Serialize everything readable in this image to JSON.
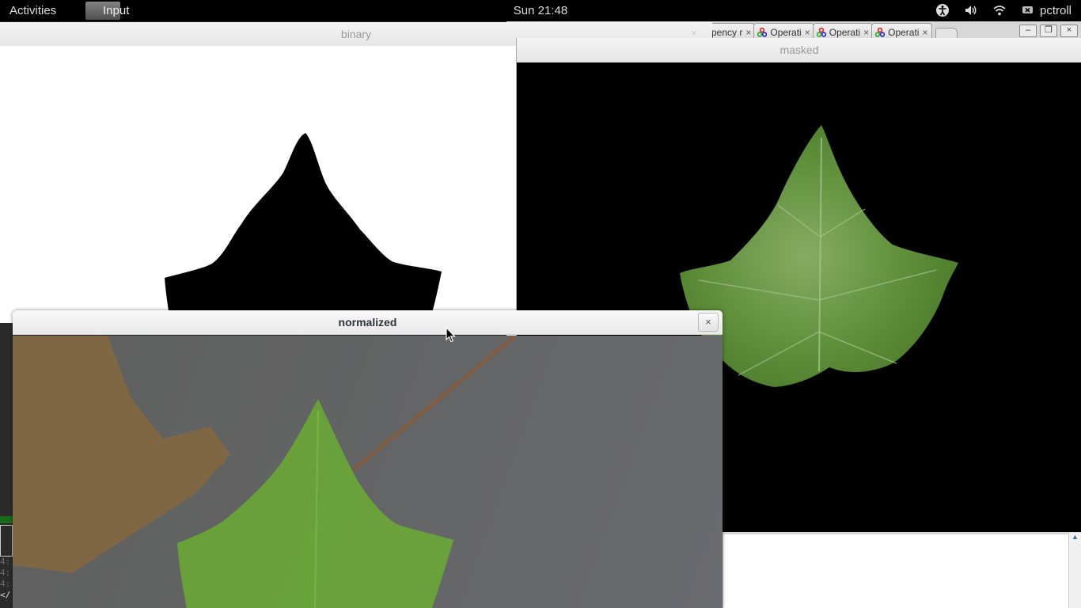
{
  "topbar": {
    "activities": "Activities",
    "app_menu": "Input",
    "clock": "Sun 21:48",
    "user": "pctroll",
    "status_icons": [
      "accessibility-icon",
      "volume-icon",
      "wifi-icon",
      "chat-status-icon"
    ]
  },
  "browser": {
    "tabs": [
      {
        "label": "pency r",
        "icon": ""
      },
      {
        "label": "Operati",
        "icon": "opencv-icon"
      },
      {
        "label": "Operati",
        "icon": "opencv-icon"
      },
      {
        "label": "Operati",
        "icon": "opencv-icon"
      }
    ],
    "tab_close": "×",
    "window_controls": [
      "–",
      "❐",
      "×"
    ]
  },
  "terminal": {
    "lines": [
      "4:",
      "4:",
      "4:"
    ],
    "prompt": "</"
  },
  "windows": {
    "binary": {
      "title": "binary",
      "close": "×"
    },
    "masked": {
      "title": "masked"
    },
    "normalized": {
      "title": "normalized",
      "close": "×"
    }
  },
  "colors": {
    "leaf_green": "#5f8f3b",
    "leaf_bright_green": "#6cbb2a",
    "paper_orange": "#8a6a3a",
    "background_gray": "#636363"
  }
}
